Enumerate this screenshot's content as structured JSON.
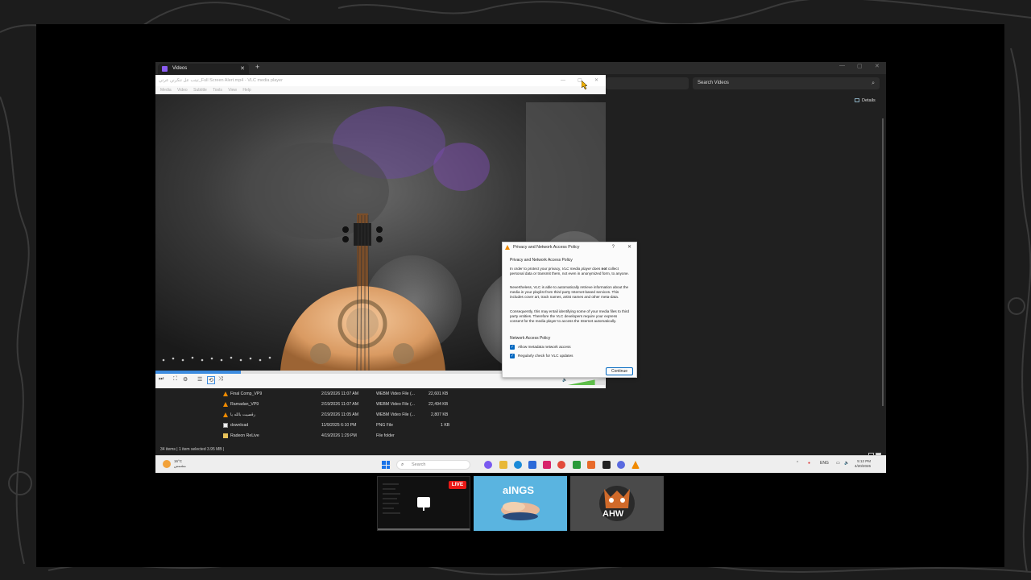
{
  "explorer": {
    "tab_title": "Videos",
    "new_tab": "+",
    "search_placeholder": "Search Videos",
    "details_label": "Details",
    "files": [
      {
        "name": "Final Comp_VP9",
        "date": "2/19/2026 11:07 AM",
        "type": "WEBM Video File (...",
        "size": "22,601 KB"
      },
      {
        "name": "Ramadan_VP9",
        "date": "2/19/2026 11:07 AM",
        "type": "WEBM Video File (...",
        "size": "22,494 KB"
      },
      {
        "name": "رقصيت بالله يا",
        "date": "2/19/2026 11:05 AM",
        "type": "WEBM Video File (...",
        "size": "2,807 KB"
      },
      {
        "name": "download",
        "date": "11/9/2025 6:10 PM",
        "type": "PNG File",
        "size": "1 KB"
      },
      {
        "name": "Radeon ReLive",
        "date": "4/19/2026 1:29 PM",
        "type": "File folder",
        "size": ""
      }
    ],
    "status_text": "34 items  |  1 item selected  3.95 MB  |"
  },
  "vlc": {
    "title": "تيتب عل تنكرنن عرتي_Full Screen Alert.mp4 - VLC media player",
    "menu": [
      "Media",
      "Video",
      "Subtitle",
      "Tools",
      "View",
      "Help"
    ],
    "progress": 0.19,
    "volume_label": "73%",
    "volume": 0.73
  },
  "dialog": {
    "title": "Privacy and Network Access Policy",
    "help": "?",
    "close": "✕",
    "heading": "Privacy and Network Access Policy",
    "p1_a": "In order to protect your privacy, ",
    "p1_app": "VLC media player",
    "p1_b": " does ",
    "p1_not": "not",
    "p1_c": " collect personal data or transmit them, not even in anonymized form, to anyone.",
    "p2": "Nevertheless, VLC is able to automatically retrieve information about the media in your playlist from third party Internet-based services. This includes cover art, track names, artist names and other meta-data.",
    "p3": "Consequently, this may entail identifying some of your media files to third party entities. Therefore the VLC developers require your express consent for the media player to access the Internet automatically.",
    "section": "Network Access Policy",
    "check1": "Allow metadata network access",
    "check2": "Regularly check for VLC updates",
    "continue": "Continue"
  },
  "taskbar": {
    "weather_temp": "16°C",
    "weather_text": "مشمس",
    "search": "Search",
    "lang": "ENG",
    "time": "5:12 PM",
    "date": "4/20/2026"
  },
  "stream": {
    "live_badge": "LIVE",
    "logo1_text": "aINGS",
    "logo2_text": "AHW"
  },
  "icons": {
    "windows": "windows-start-icon",
    "search": "search-icon",
    "vlc": "vlc-cone-icon"
  },
  "colors": {
    "accent": "#0067c0",
    "live": "#e91916",
    "seek": "#3d8ce0"
  }
}
